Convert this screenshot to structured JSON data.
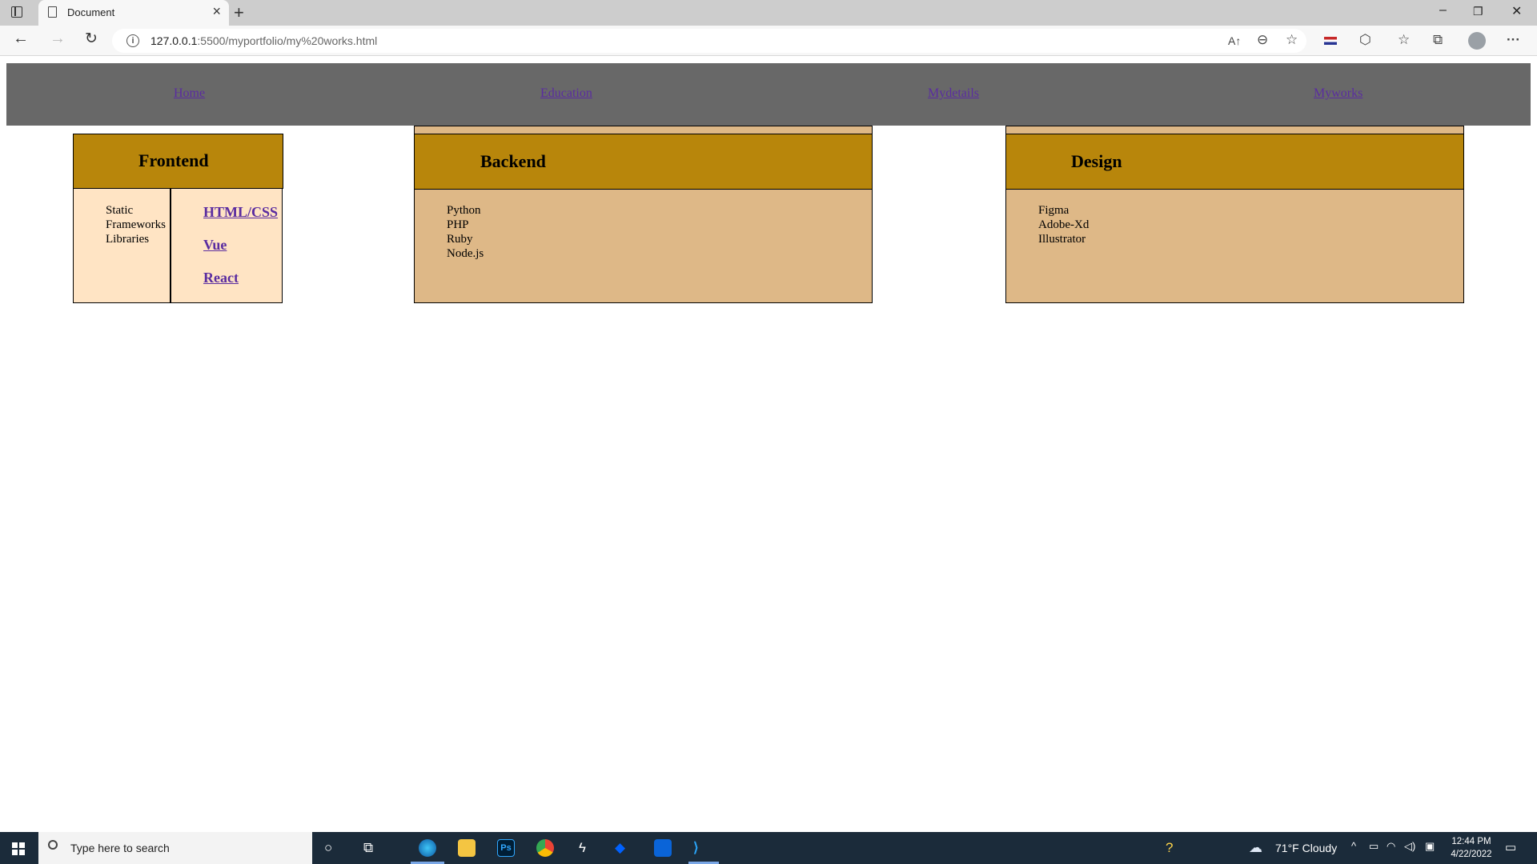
{
  "browser": {
    "tab_title": "Document",
    "url_prefix": "127.0.0.1",
    "url_rest": ":5500/myportfolio/my%20works.html",
    "icons": [
      "tab-actions-icon",
      "document-icon",
      "close-icon",
      "plus-icon",
      "back-icon",
      "forward-icon",
      "refresh-icon",
      "info-icon",
      "read-aloud-icon",
      "zoom-out-icon",
      "favorite-add-icon",
      "extension-flag-icon",
      "extensions-icon",
      "favorites-icon",
      "collections-icon",
      "profile-icon",
      "more-icon",
      "minimize-icon",
      "restore-icon",
      "window-close-icon"
    ]
  },
  "nav": {
    "links": [
      "Home",
      "Education",
      "Mydetails",
      "Myworks"
    ]
  },
  "cards": {
    "frontend": {
      "title": "Frontend",
      "items": [
        "Static",
        "Frameworks",
        "Libraries"
      ],
      "links": [
        "HTML/CSS",
        "Vue",
        "React"
      ]
    },
    "backend": {
      "title": "Backend",
      "items": [
        "Python",
        "PHP",
        "Ruby",
        "Node.js"
      ]
    },
    "design": {
      "title": "Design",
      "items": [
        "Figma",
        "Adobe-Xd",
        "Illustrator"
      ]
    }
  },
  "colors": {
    "header_bar": "#686868",
    "card_head": "#b8860b",
    "card_body": "#deb887",
    "frontend_body": "#ffe4c4",
    "link": "#5a2ca0"
  },
  "taskbar": {
    "search_placeholder": "Type here to search",
    "weather": "71°F  Cloudy",
    "time": "12:44 PM",
    "date": "4/22/2022"
  }
}
